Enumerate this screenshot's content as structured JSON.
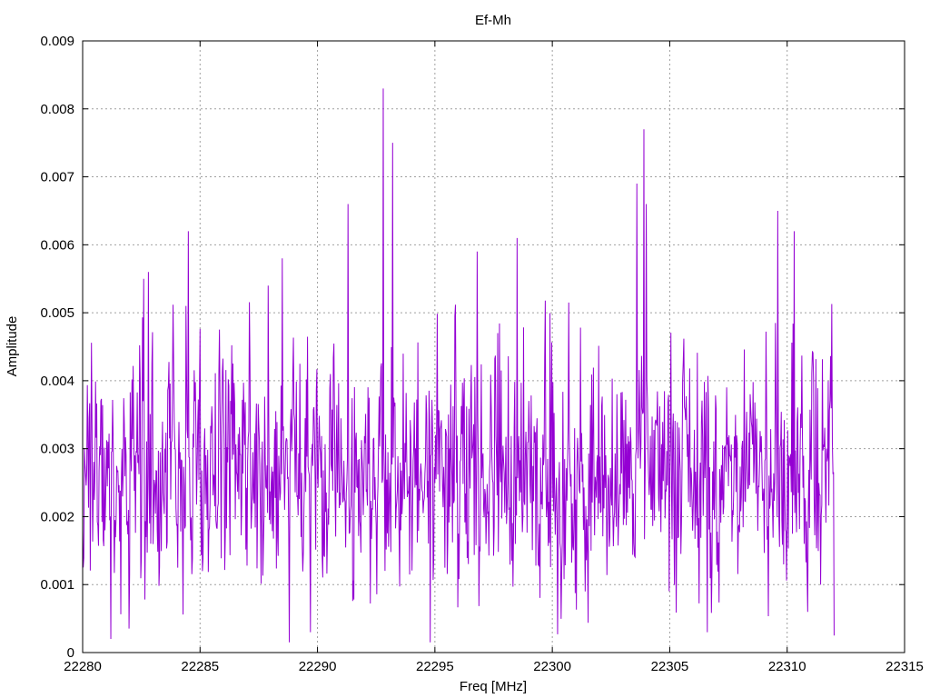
{
  "chart_data": {
    "type": "line",
    "title": "Ef-Mh",
    "xlabel": "Freq [MHz]",
    "ylabel": "Amplitude",
    "xlim": [
      22280,
      22315
    ],
    "ylim": [
      0,
      0.009
    ],
    "x_ticks": [
      22280,
      22285,
      22290,
      22295,
      22300,
      22305,
      22310,
      22315
    ],
    "x_tick_labels": [
      "22280",
      "22285",
      "22290",
      "22295",
      "22300",
      "22305",
      "22310",
      "22315"
    ],
    "y_ticks": [
      0,
      0.001,
      0.002,
      0.003,
      0.004,
      0.005,
      0.006,
      0.007,
      0.008,
      0.009
    ],
    "y_tick_labels": [
      "0",
      "0.001",
      "0.002",
      "0.003",
      "0.004",
      "0.005",
      "0.006",
      "0.007",
      "0.008",
      "0.009"
    ],
    "grid": true,
    "legend": "none",
    "series": [
      {
        "color": "#9400d3",
        "x_start": 22280,
        "x_step": 0.025,
        "count": 1281,
        "x_end": 22312,
        "mean": 0.0026,
        "min": 0.00015,
        "max": 0.0083,
        "peaks": [
          {
            "x": 22282.6,
            "y": 0.0055
          },
          {
            "x": 22282.8,
            "y": 0.0056
          },
          {
            "x": 22284.5,
            "y": 0.0062
          },
          {
            "x": 22284.4,
            "y": 0.0051
          },
          {
            "x": 22287.9,
            "y": 0.0054
          },
          {
            "x": 22288.5,
            "y": 0.0058
          },
          {
            "x": 22291.3,
            "y": 0.0066
          },
          {
            "x": 22292.8,
            "y": 0.0083
          },
          {
            "x": 22293.2,
            "y": 0.0075
          },
          {
            "x": 22294.8,
            "y": 0.0058
          },
          {
            "x": 22296.8,
            "y": 0.0059
          },
          {
            "x": 22298.5,
            "y": 0.0061
          },
          {
            "x": 22303.6,
            "y": 0.0069
          },
          {
            "x": 22303.9,
            "y": 0.0077
          },
          {
            "x": 22304.0,
            "y": 0.0066
          },
          {
            "x": 22306.6,
            "y": 0.0062
          },
          {
            "x": 22309.6,
            "y": 0.0065
          },
          {
            "x": 22310.3,
            "y": 0.0062
          }
        ],
        "dips": [
          {
            "x": 22281.2,
            "y": 0.0002
          },
          {
            "x": 22288.8,
            "y": 0.00015
          },
          {
            "x": 22289.7,
            "y": 0.0003
          },
          {
            "x": 22294.8,
            "y": 0.00015
          },
          {
            "x": 22306.6,
            "y": 0.0003
          },
          {
            "x": 22312.0,
            "y": 0.00025
          }
        ]
      }
    ]
  }
}
